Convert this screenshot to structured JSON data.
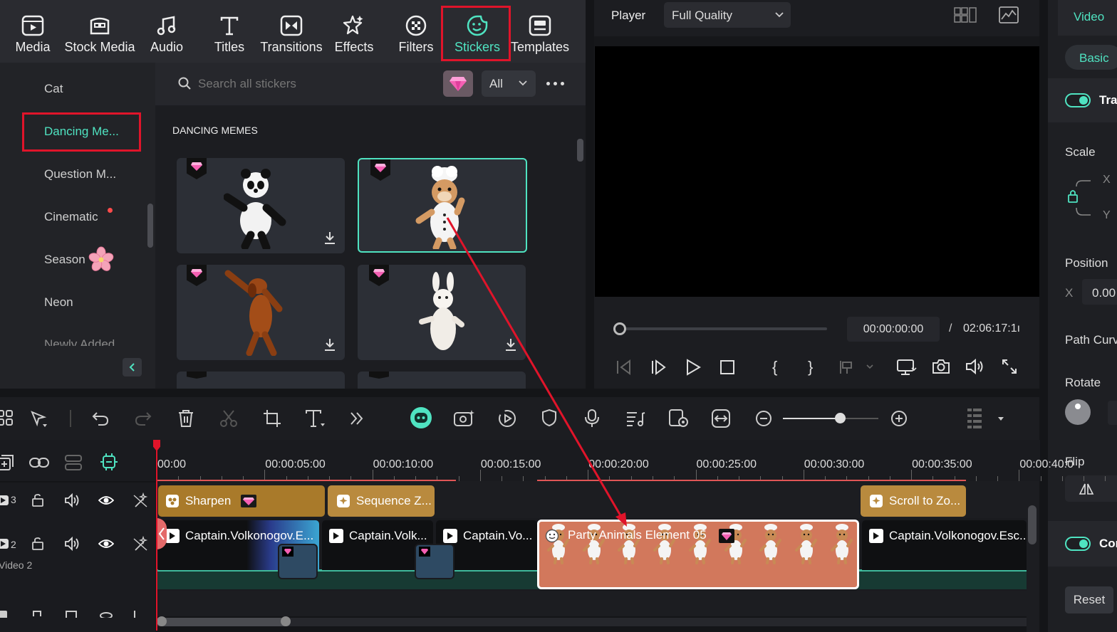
{
  "toolbar": {
    "tabs": [
      {
        "label": "Media",
        "icon": "media-icon"
      },
      {
        "label": "Stock Media",
        "icon": "stock-media-icon"
      },
      {
        "label": "Audio",
        "icon": "audio-icon"
      },
      {
        "label": "Titles",
        "icon": "titles-icon"
      },
      {
        "label": "Transitions",
        "icon": "transitions-icon"
      },
      {
        "label": "Effects",
        "icon": "effects-icon"
      },
      {
        "label": "Filters",
        "icon": "filters-icon"
      },
      {
        "label": "Stickers",
        "icon": "stickers-icon",
        "active": true
      },
      {
        "label": "Templates",
        "icon": "templates-icon"
      }
    ]
  },
  "categories": [
    {
      "label": "Cat"
    },
    {
      "label": "Dancing Me...",
      "active": true
    },
    {
      "label": "Question M..."
    },
    {
      "label": "Cinematic",
      "badge": "new-dot"
    },
    {
      "label": "Season",
      "icon": "sakura-icon"
    },
    {
      "label": "Neon"
    },
    {
      "label": "Newly Added"
    }
  ],
  "search": {
    "placeholder": "Search all stickers",
    "filter_value": "All"
  },
  "sticker_section": {
    "title": "DANCING MEMES",
    "items": [
      {
        "subject": "panda-sticker",
        "premium": true
      },
      {
        "subject": "chef-hamster-sticker",
        "premium": true,
        "selected": true
      },
      {
        "subject": "dog-sticker",
        "premium": true
      },
      {
        "subject": "rabbit-sticker",
        "premium": true
      }
    ]
  },
  "player": {
    "label": "Player",
    "quality": "Full Quality",
    "current_time": "00:00:00:00",
    "separator": "/",
    "total_time": "02:06:17:1ı"
  },
  "right_panel": {
    "tab_video": "Video",
    "tab_basic": "Basic",
    "transform_label": "Tra",
    "scale_label": "Scale",
    "scale_x": "X",
    "scale_y": "Y",
    "position_label": "Position",
    "position_x_label": "X",
    "position_x_value": "0.00",
    "path_curve_label": "Path Curv",
    "rotate_label": "Rotate",
    "flip_label": "Flip",
    "compositing_label": "Cor",
    "reset_label": "Reset"
  },
  "timeline": {
    "ruler_ticks": [
      "00:00",
      "00:00:05:00",
      "00:00:10:00",
      "00:00:15:00",
      "00:00:20:00",
      "00:00:25:00",
      "00:00:30:00",
      "00:00:35:00",
      "00:00:40:0"
    ],
    "tracks": [
      {
        "number": "3",
        "name": ""
      },
      {
        "number": "2",
        "name": "Video 2"
      }
    ],
    "effect_clips": [
      "Sharpen",
      "Sequence Z...",
      "Scroll to Zo..."
    ],
    "video_clips": [
      "Captain.Volkonogov.E...",
      "Captain.Volk...",
      "Captain.Vo...",
      "Captain.Volkonogov.Esc..."
    ],
    "sticker_clip": "Party Animals Element 05"
  },
  "colors": {
    "accent": "#4fe3c1",
    "highlight": "#e0142a",
    "sticker_clip": "#d2785c",
    "effect_clip": "#a97a2a"
  }
}
